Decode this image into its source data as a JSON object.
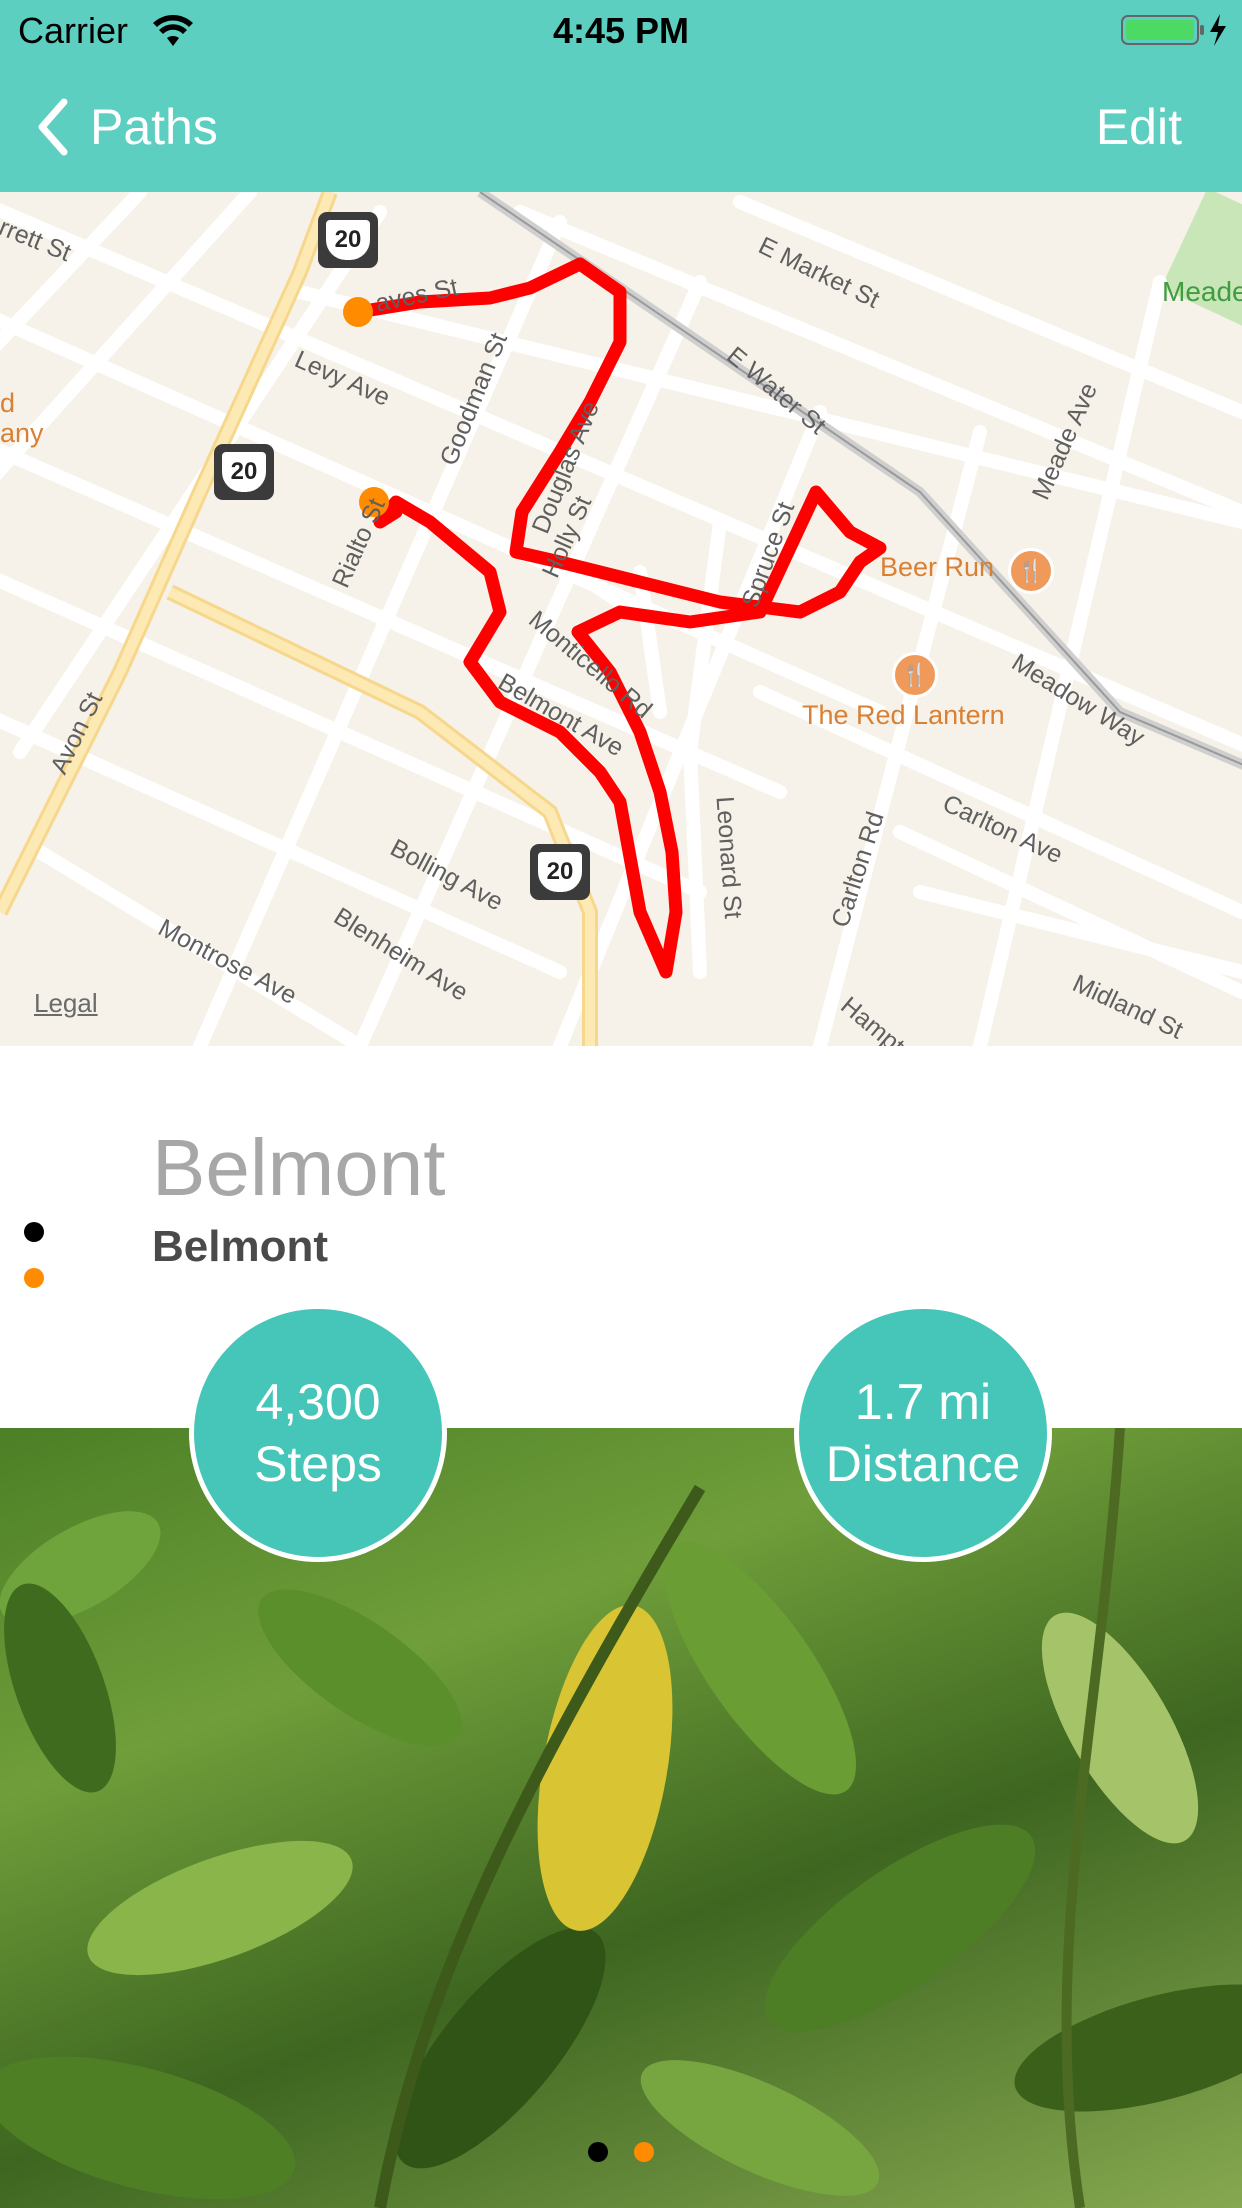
{
  "status_bar": {
    "carrier": "Carrier",
    "time": "4:45 PM"
  },
  "nav": {
    "back_label": "Paths",
    "edit_label": "Edit"
  },
  "map": {
    "streets": [
      "rrett St",
      "E Market St",
      "E Water St",
      "Meade Ave",
      "Meadow Way",
      "Carlton Ave",
      "Carlton Rd",
      "Leonard St",
      "Midland St",
      "Hampt",
      "Levy Ave",
      "aves St",
      "Goodman St",
      "Douglas Ave",
      "Holly St",
      "Spruce St",
      "Monticello Rd",
      "Belmont Ave",
      "Rialto St",
      "Avon St",
      "Bolling Ave",
      "Blenheim Ave",
      "Montrose Ave"
    ],
    "pois": [
      "Beer Run",
      "The Red Lantern"
    ],
    "park_label": "Meade",
    "edge_label_1": "d",
    "edge_label_2": "any",
    "highway_number": "20",
    "legal": "Legal",
    "route_color": "#ff0000",
    "marker_color": "#ff8c00"
  },
  "path": {
    "title": "Belmont",
    "subtitle": "Belmont"
  },
  "stats": {
    "steps_value": "4,300",
    "steps_label": "Steps",
    "distance_value": "1.7 mi",
    "distance_label": "Distance"
  },
  "colors": {
    "accent": "#5ccfc0",
    "stat_circle": "#45c6b8",
    "page_dot_active": "#000000",
    "page_dot_inactive": "#ff8c00"
  },
  "pager": {
    "page_count": 2,
    "current_page": 1
  }
}
